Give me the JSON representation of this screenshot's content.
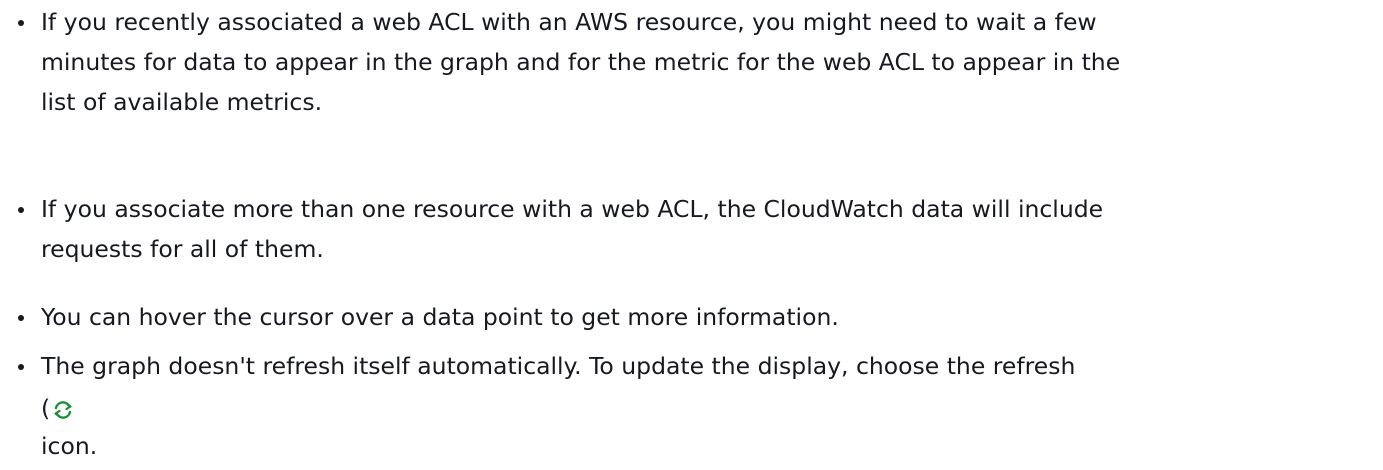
{
  "notes": [
    {
      "lines": [
        "If you recently associated a web ACL with an AWS resource, you might need to wait a few",
        "minutes for data to appear in the graph and for the metric for the web ACL to appear in the",
        "list of available metrics."
      ]
    },
    {
      "lines": [
        "If you associate more than one resource with a web ACL, the CloudWatch data will include",
        "requests for all of them."
      ]
    },
    {
      "lines": [
        "You can hover the cursor over a data point to get more information."
      ]
    },
    {
      "lines": [
        "The graph doesn't refresh itself automatically. To update the display, choose the refresh"
      ],
      "open_paren": "(",
      "icon": "refresh-icon",
      "tail": "icon."
    }
  ],
  "colors": {
    "text": "#16191f",
    "icon_stroke": "#1b8f3a"
  }
}
